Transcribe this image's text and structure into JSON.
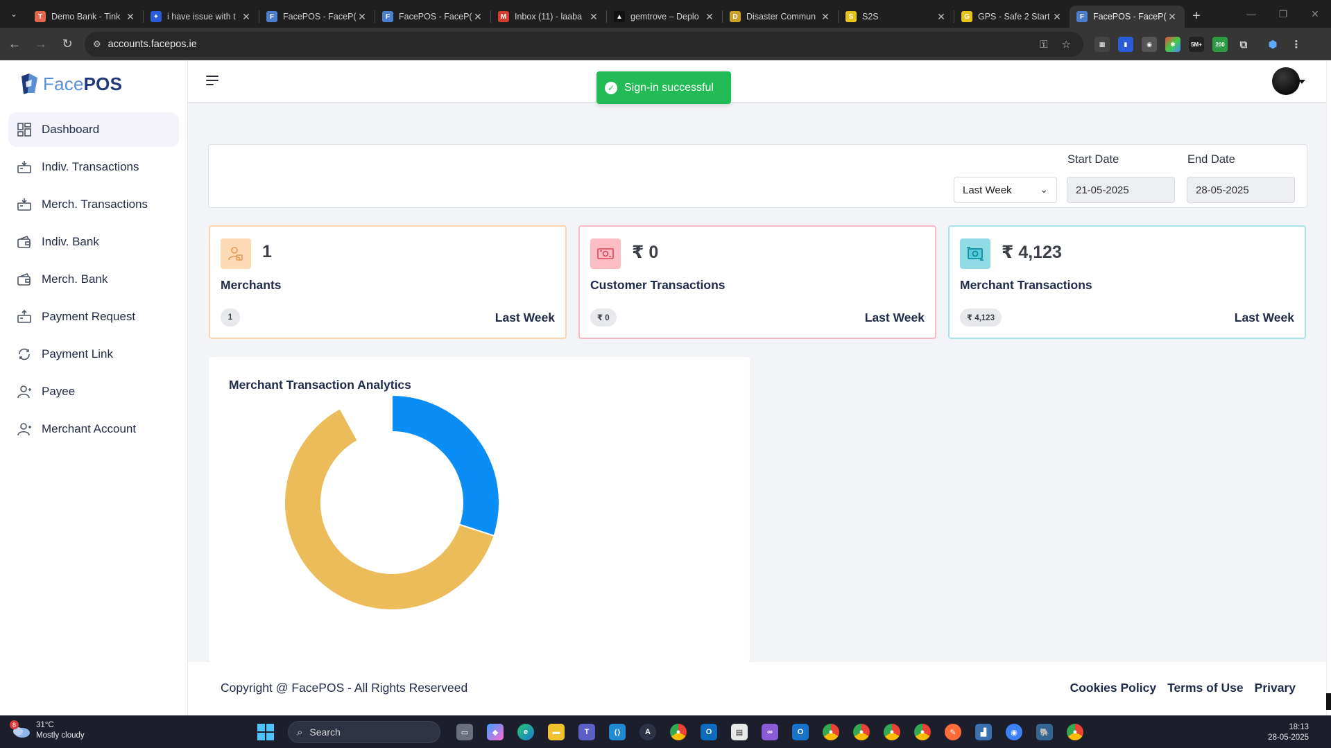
{
  "browser": {
    "tabs": [
      {
        "title": "Demo Bank - Tink",
        "color": "#e2664a",
        "glyph": "T"
      },
      {
        "title": "i have issue with t",
        "color": "#2b5bd7",
        "glyph": "✦"
      },
      {
        "title": "FacePOS - FaceP(",
        "color": "#4a7fd0",
        "glyph": "F"
      },
      {
        "title": "FacePOS - FaceP(",
        "color": "#4a7fd0",
        "glyph": "F"
      },
      {
        "title": "Inbox (11) - laaba",
        "color": "#d23f31",
        "glyph": "M"
      },
      {
        "title": "gemtrove – Deplo",
        "color": "#111111",
        "glyph": "▲"
      },
      {
        "title": "Disaster Commun",
        "color": "#c9a227",
        "glyph": "D"
      },
      {
        "title": "S2S",
        "color": "#e9c21b",
        "glyph": "S"
      },
      {
        "title": "GPS - Safe 2 Start",
        "color": "#e9c21b",
        "glyph": "G"
      },
      {
        "title": "FacePOS - FaceP(",
        "color": "#4a7fd0",
        "glyph": "F"
      }
    ],
    "url": "accounts.facepos.ie"
  },
  "brand": {
    "light": "Face",
    "bold": "POS"
  },
  "sidebar": {
    "items": [
      {
        "label": "Dashboard"
      },
      {
        "label": "Indiv. Transactions"
      },
      {
        "label": "Merch. Transactions"
      },
      {
        "label": "Indiv. Bank"
      },
      {
        "label": "Merch. Bank"
      },
      {
        "label": "Payment Request"
      },
      {
        "label": "Payment Link"
      },
      {
        "label": "Payee"
      },
      {
        "label": "Merchant Account"
      }
    ]
  },
  "toast": {
    "message": "Sign-in successful"
  },
  "filter": {
    "period": "Last Week",
    "start_label": "Start Date",
    "end_label": "End Date",
    "start_date": "21-05-2025",
    "end_date": "28-05-2025"
  },
  "stats": [
    {
      "value": "1",
      "title": "Merchants",
      "badge": "1",
      "period": "Last Week",
      "accent": "#fbd5b0",
      "icon_bg": "#fdd9b5"
    },
    {
      "value": "₹ 0",
      "title": "Customer Transactions",
      "badge": "₹ 0",
      "period": "Last Week",
      "accent": "#f8b9c2",
      "icon_bg": "#fbbcc3"
    },
    {
      "value": "₹ 4,123",
      "title": "Merchant Transactions",
      "badge": "₹ 4,123",
      "period": "Last Week",
      "accent": "#a7e3ea",
      "icon_bg": "#8fdbe6"
    }
  ],
  "chart": {
    "title": "Merchant Transaction Analytics"
  },
  "chart_data": {
    "type": "pie",
    "variant": "donut",
    "slices": [
      {
        "value": 30,
        "color": "#0a8ef5"
      },
      {
        "value": 62,
        "color": "#ecbc5a"
      },
      {
        "value": 8,
        "color": "#ffffff"
      }
    ],
    "legend": "none"
  },
  "footer": {
    "copyright": "Copyright @ FacePOS - All Rights Reserveed",
    "links": [
      "Cookies Policy",
      "Terms of Use",
      "Privary"
    ]
  },
  "taskbar": {
    "weather_badge": "8",
    "temperature": "31°C",
    "condition": "Mostly cloudy",
    "search_placeholder": "Search",
    "time": "18:13",
    "date": "28-05-2025"
  }
}
